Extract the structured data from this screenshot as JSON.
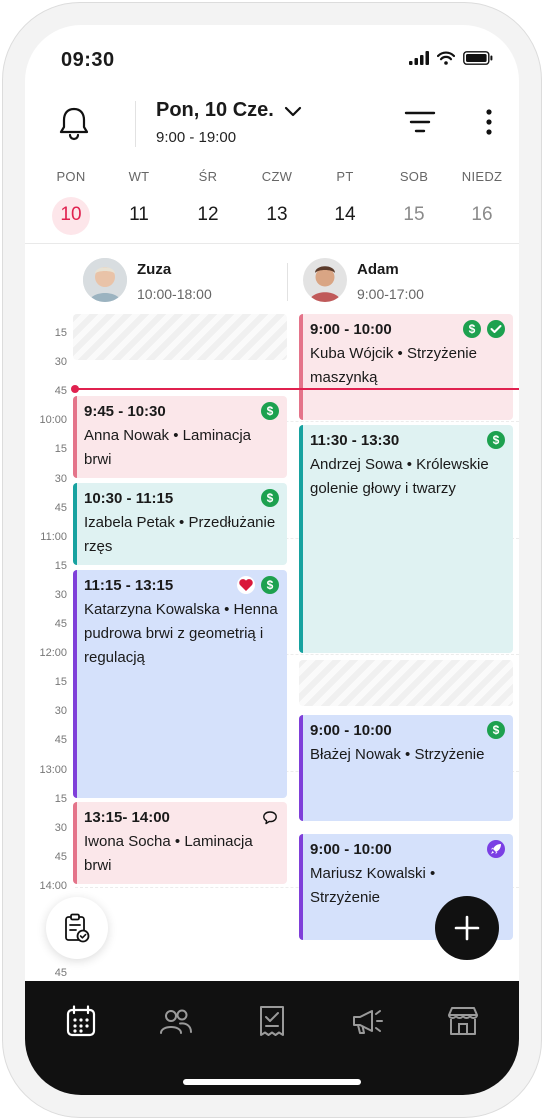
{
  "status_bar": {
    "time": "09:30"
  },
  "header": {
    "date_title": "Pon, 10 Cze.",
    "hours": "9:00 - 19:00"
  },
  "week": [
    {
      "label": "PON",
      "num": "10",
      "state": "active"
    },
    {
      "label": "WT",
      "num": "11",
      "state": "normal"
    },
    {
      "label": "ŚR",
      "num": "12",
      "state": "normal"
    },
    {
      "label": "CZW",
      "num": "13",
      "state": "normal"
    },
    {
      "label": "PT",
      "num": "14",
      "state": "normal"
    },
    {
      "label": "SOB",
      "num": "15",
      "state": "muted"
    },
    {
      "label": "NIEDZ",
      "num": "16",
      "state": "muted"
    }
  ],
  "staff": [
    {
      "name": "Zuza",
      "hours": "10:00-18:00"
    },
    {
      "name": "Adam",
      "hours": "9:00-17:00"
    }
  ],
  "time_labels": [
    "15",
    "30",
    "45",
    "10:00",
    "15",
    "30",
    "45",
    "11:00",
    "15",
    "30",
    "45",
    "12:00",
    "15",
    "30",
    "45",
    "13:00",
    "15",
    "30",
    "45",
    "14:00",
    "15",
    "30",
    "45"
  ],
  "appointments_zuza": [
    {
      "time": "9:45 - 10:30",
      "desc": "Anna Nowak • Laminacja brwi",
      "color": "pink",
      "icons": [
        "dollar"
      ]
    },
    {
      "time": "10:30 - 11:15",
      "desc": "Izabela Petak • Przedłużanie rzęs",
      "color": "teal",
      "icons": [
        "dollar"
      ]
    },
    {
      "time": "11:15 - 13:15",
      "desc": "Katarzyna Kowalska • Henna pudrowa brwi z geometrią i regulacją",
      "color": "blue",
      "icons": [
        "heart",
        "dollar"
      ]
    },
    {
      "time": "13:15- 14:00",
      "desc": "Iwona Socha • Laminacja brwi",
      "color": "pink",
      "icons": [
        "comment"
      ]
    }
  ],
  "appointments_adam": [
    {
      "time": "9:00 - 10:00",
      "desc": "Kuba Wójcik • Strzyżenie maszynką",
      "color": "pink",
      "icons": [
        "dollar",
        "check"
      ]
    },
    {
      "time": "11:30 - 13:30",
      "desc": "Andrzej Sowa • Królewskie golenie głowy i twarzy",
      "color": "teal",
      "icons": [
        "dollar"
      ]
    },
    {
      "time": "9:00 - 10:00",
      "desc": "Błażej Nowak • Strzyżenie",
      "color": "blue",
      "icons": [
        "dollar"
      ]
    },
    {
      "time": "9:00 - 10:00",
      "desc": "Mariusz Kowalski • Strzyżenie",
      "color": "blue",
      "icons": [
        "rocket"
      ]
    }
  ],
  "colors": {
    "accent": "#e0214f",
    "dark": "#111111",
    "green": "#1da14f",
    "purple": "#7f3fd9",
    "teal": "#17a2a0"
  },
  "bottom_nav": [
    "calendar-icon",
    "clients-icon",
    "receipt-icon",
    "megaphone-icon",
    "store-icon"
  ]
}
